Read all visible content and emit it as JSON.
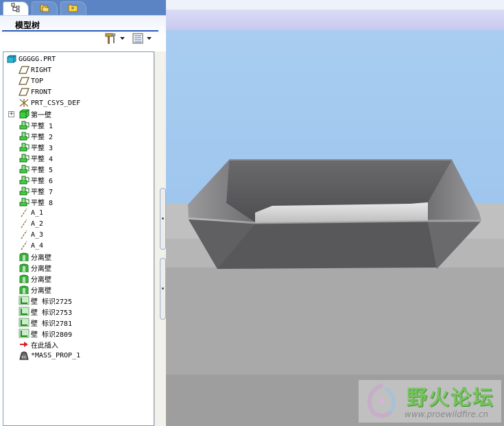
{
  "panel": {
    "title": "模型树",
    "tabs": [
      {
        "name": "model-tree-tab",
        "icon": "model-tree-icon",
        "active": true
      },
      {
        "name": "folder-browser-tab",
        "icon": "folder-icon",
        "active": false
      },
      {
        "name": "favorites-tab",
        "icon": "favorites-folder-icon",
        "active": false
      }
    ],
    "tools": [
      {
        "name": "settings-button",
        "icon": "hammer-settings-icon"
      },
      {
        "name": "show-button",
        "icon": "list-show-icon"
      }
    ]
  },
  "tree": {
    "items": [
      {
        "label": "GGGGG.PRT",
        "icon": "part-icon",
        "indent": 0
      },
      {
        "label": "RIGHT",
        "icon": "datum-plane-icon",
        "indent": 1
      },
      {
        "label": "TOP",
        "icon": "datum-plane-icon",
        "indent": 1
      },
      {
        "label": "FRONT",
        "icon": "datum-plane-icon",
        "indent": 1
      },
      {
        "label": "PRT_CSYS_DEF",
        "icon": "csys-icon",
        "indent": 1
      },
      {
        "label": "第一壁",
        "icon": "first-wall-icon",
        "indent": 1,
        "expandable": true
      },
      {
        "label": "平整 1",
        "icon": "flat-wall-icon",
        "indent": 1
      },
      {
        "label": "平整 2",
        "icon": "flat-wall-icon",
        "indent": 1
      },
      {
        "label": "平整 3",
        "icon": "flat-wall-icon",
        "indent": 1
      },
      {
        "label": "平整 4",
        "icon": "flat-wall-icon",
        "indent": 1
      },
      {
        "label": "平整 5",
        "icon": "flat-wall-icon",
        "indent": 1
      },
      {
        "label": "平整 6",
        "icon": "flat-wall-icon",
        "indent": 1
      },
      {
        "label": "平整 7",
        "icon": "flat-wall-icon",
        "indent": 1
      },
      {
        "label": "平整 8",
        "icon": "flat-wall-icon",
        "indent": 1
      },
      {
        "label": "A_1",
        "icon": "datum-axis-icon",
        "indent": 1
      },
      {
        "label": "A_2",
        "icon": "datum-axis-icon",
        "indent": 1
      },
      {
        "label": "A_3",
        "icon": "datum-axis-icon",
        "indent": 1
      },
      {
        "label": "A_4",
        "icon": "datum-axis-icon",
        "indent": 1
      },
      {
        "label": "分离壁",
        "icon": "unattached-wall-icon",
        "indent": 1
      },
      {
        "label": "分离壁",
        "icon": "unattached-wall-icon",
        "indent": 1
      },
      {
        "label": "分离壁",
        "icon": "unattached-wall-icon",
        "indent": 1
      },
      {
        "label": "分离壁",
        "icon": "unattached-wall-icon",
        "indent": 1
      },
      {
        "label": "壁 标识2725",
        "icon": "merge-wall-icon",
        "indent": 1
      },
      {
        "label": "壁 标识2753",
        "icon": "merge-wall-icon",
        "indent": 1
      },
      {
        "label": "壁 标识2781",
        "icon": "merge-wall-icon",
        "indent": 1
      },
      {
        "label": "壁 标识2809",
        "icon": "merge-wall-icon",
        "indent": 1
      },
      {
        "label": "在此插入",
        "icon": "insert-here-arrow-icon",
        "indent": 1
      },
      {
        "label": "*MASS_PROP_1",
        "icon": "mass-prop-icon",
        "indent": 1
      }
    ]
  },
  "watermark": {
    "title": "野火论坛",
    "url": "www.proewildfire.cn"
  },
  "colors": {
    "tab_strip": "#5b84c4",
    "accent": "#2b5ab8",
    "sky": "#a8cdf0",
    "model": "#555558",
    "feature_green": "#3ecf3e"
  }
}
